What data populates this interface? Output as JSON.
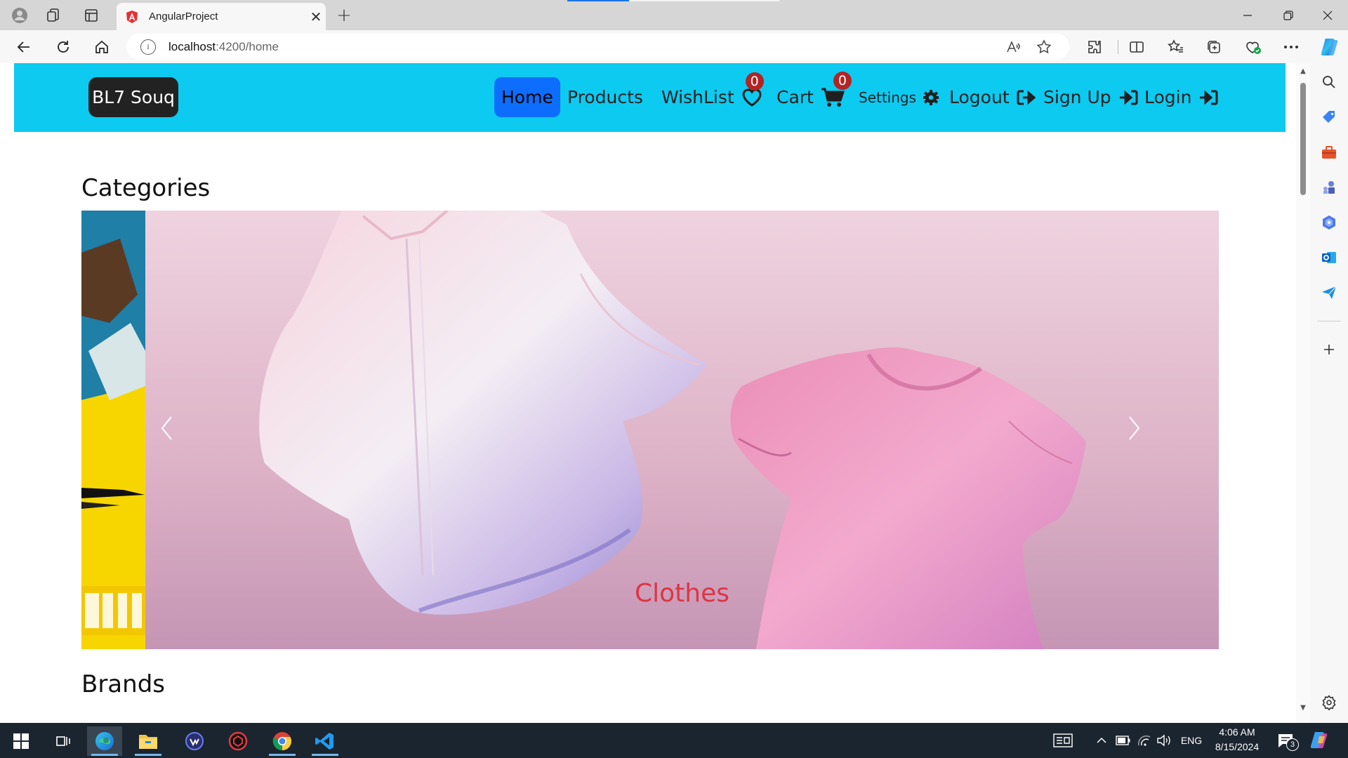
{
  "browser": {
    "tab_title": "AngularProject",
    "url_host": "localhost",
    "url_path": ":4200/home",
    "tab_close_glyph": "✕",
    "new_tab_glyph": "+"
  },
  "site": {
    "brand": "BL7 Souq",
    "nav": {
      "home": "Home",
      "products": "Products",
      "wishlist": "WishList",
      "wishlist_count": "0",
      "cart": "Cart",
      "cart_count": "0",
      "settings": "Settings",
      "logout": "Logout",
      "signup": "Sign Up",
      "login": "Login"
    },
    "colors": {
      "navbar": "#0dcaf0",
      "active_link": "#0d6efd",
      "badge": "#b32424",
      "caption": "#dc3545"
    }
  },
  "content": {
    "categories_title": "Categories",
    "carousel": {
      "active_caption": "Clothes",
      "prev_icon": "chevron-left-icon",
      "next_icon": "chevron-right-icon"
    },
    "brands_title": "Brands"
  },
  "taskbar": {
    "language": "ENG",
    "time": "4:06 AM",
    "date": "8/15/2024",
    "notification_count": "3"
  }
}
